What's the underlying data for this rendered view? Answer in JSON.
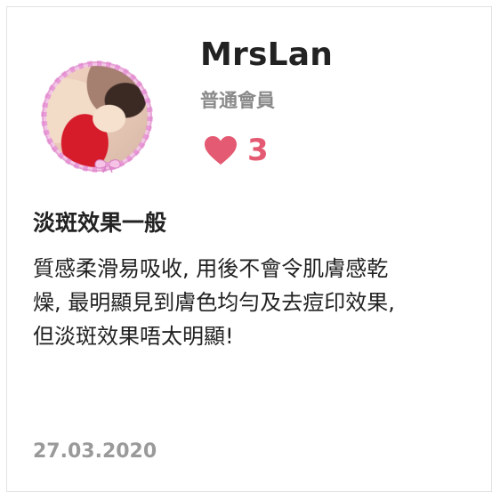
{
  "review": {
    "username": "MrsLan",
    "member_level": "普通會員",
    "like_count": "3",
    "title": "淡斑效果一般",
    "body": "質感柔滑易吸收, 用後不會令肌膚感乾\n燥, 最明顯見到膚色均勻及去痘印效果,\n但淡斑效果唔太明顯!",
    "date": "27.03.2020"
  },
  "icons": {
    "like": "heart-icon",
    "avatar_ring": "lace-ring-icon",
    "avatar_bow": "bow-icon"
  },
  "colors": {
    "heart": "#E35A72",
    "like_count": "#E35A72",
    "member_level": "#8A8A8A",
    "date": "#9A9A9A",
    "text": "#222222",
    "card_border": "#E2E2E2",
    "avatar_ring": "#E7A6D6"
  }
}
